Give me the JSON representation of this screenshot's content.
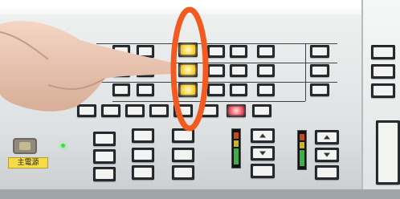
{
  "scene": {
    "description_label": "panel_photo",
    "tag_label": "主電源",
    "highlight_color": "#f25a1f",
    "lit_button_color": "#ffe066",
    "red_button_color": "#ff6b78",
    "status_led_color": "#35e04a"
  },
  "icons": [
    "up-arrow-icon",
    "down-arrow-icon"
  ]
}
